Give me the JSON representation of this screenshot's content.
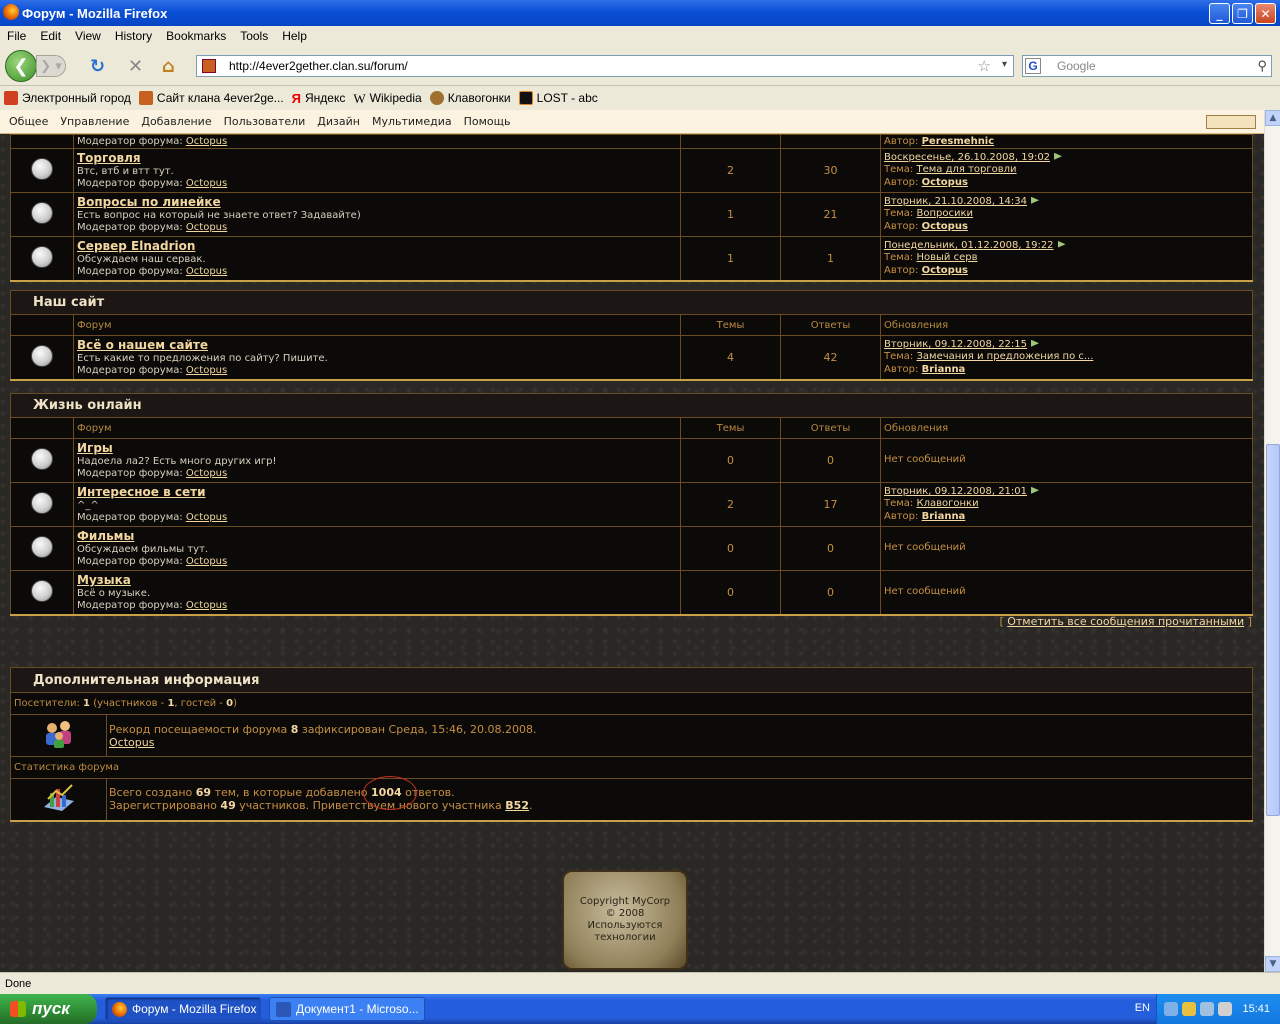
{
  "window": {
    "title": "Форум - Mozilla Firefox"
  },
  "menu": [
    "File",
    "Edit",
    "View",
    "History",
    "Bookmarks",
    "Tools",
    "Help"
  ],
  "nav": {
    "url": "http://4ever2gether.clan.su/forum/",
    "search_placeholder": "Google"
  },
  "bookmarks": [
    "Электронный город",
    "Сайт клана 4ever2ge...",
    "Яндекс",
    "Wikipedia",
    "Клавогонки",
    "LOST - abc"
  ],
  "admin_menu": [
    "Общее",
    "Управление",
    "Добавление",
    "Пользователи",
    "Дизайн",
    "Мультимедиа",
    "Помощь"
  ],
  "partial_row": {
    "author_label": "Автор:",
    "author": "Peresmehnic",
    "mod_label": "Модератор форума:",
    "mod": "Octopus"
  },
  "forums_top": [
    {
      "name": "Торговля",
      "desc": "Втс, втб и втт тут.",
      "mod_label": "Модератор форума:",
      "mod": "Octopus",
      "topics": "2",
      "replies": "30",
      "date": "Воскресенье, 26.10.2008, 19:02",
      "topic_label": "Тема:",
      "topic": "Тема для торговли",
      "author_label": "Автор:",
      "author": "Octopus"
    },
    {
      "name": "Вопросы по линейке",
      "desc": "Есть вопрос на который не знаете ответ? Задавайте)",
      "mod_label": "Модератор форума:",
      "mod": "Octopus",
      "topics": "1",
      "replies": "21",
      "date": "Вторник, 21.10.2008, 14:34",
      "topic_label": "Тема:",
      "topic": "Вопросики",
      "author_label": "Автор:",
      "author": "Octopus"
    },
    {
      "name": "Сервер Elnadrion",
      "desc": "Обсуждаем наш сервак.",
      "mod_label": "Модератор форума:",
      "mod": "Octopus",
      "topics": "1",
      "replies": "1",
      "date": "Понедельник, 01.12.2008, 19:22",
      "topic_label": "Тема:",
      "topic": "Новый серв",
      "author_label": "Автор:",
      "author": "Octopus"
    }
  ],
  "columns": {
    "forum": "Форум",
    "topics": "Темы",
    "replies": "Ответы",
    "updates": "Обновления"
  },
  "cat_site": {
    "title": "Наш сайт",
    "forums": [
      {
        "name": "Всё о нашем сайте",
        "desc": "Есть какие то предложения по сайту? Пишите.",
        "mod_label": "Модератор форума:",
        "mod": "Octopus",
        "topics": "4",
        "replies": "42",
        "date": "Вторник, 09.12.2008, 22:15",
        "topic_label": "Тема:",
        "topic": "Замечания и предложения по с...",
        "author_label": "Автор:",
        "author": "Brianna"
      }
    ]
  },
  "cat_life": {
    "title": "Жизнь онлайн",
    "forums": [
      {
        "name": "Игры",
        "desc": "Надоела ла2? Есть много других игр!",
        "mod_label": "Модератор форума:",
        "mod": "Octopus",
        "topics": "0",
        "replies": "0",
        "empty": "Нет сообщений"
      },
      {
        "name": "Интересное в сети",
        "desc": "^_^",
        "mod_label": "Модератор форума:",
        "mod": "Octopus",
        "topics": "2",
        "replies": "17",
        "date": "Вторник, 09.12.2008, 21:01",
        "topic_label": "Тема:",
        "topic": "Клавогонки",
        "author_label": "Автор:",
        "author": "Brianna"
      },
      {
        "name": "Фильмы",
        "desc": "Обсуждаем фильмы тут.",
        "mod_label": "Модератор форума:",
        "mod": "Octopus",
        "topics": "0",
        "replies": "0",
        "empty": "Нет сообщений"
      },
      {
        "name": "Музыка",
        "desc": "Всё о музыке.",
        "mod_label": "Модератор форума:",
        "mod": "Octopus",
        "topics": "0",
        "replies": "0",
        "empty": "Нет сообщений"
      }
    ]
  },
  "mark_all": "Отметить все сообщения прочитанными",
  "info": {
    "title": "Дополнительная информация",
    "visitors_label": "Посетители:",
    "visitors": "1",
    "visitors_members_label": "(участников -",
    "visitors_members": "1",
    "visitors_guests_label": ", гостей -",
    "visitors_guests": "0",
    "record_pre": "Рекорд посещаемости форума",
    "record_count": "8",
    "record_post": "зафиксирован Среда, 15:46, 20.08.2008.",
    "record_user": "Octopus",
    "stats_label": "Статистика форума",
    "stats_pre": "Всего создано",
    "stats_topics": "69",
    "stats_mid": "тем, в которые добавлено",
    "stats_replies": "1004",
    "stats_post": "ответов.",
    "reg_pre": "Зарегистрировано",
    "reg_count": "49",
    "reg_mid": "участников. Приветствуем нового участника",
    "reg_user": "B52"
  },
  "plaque": [
    "Copyright MyCorp",
    "© 2008",
    "Используются",
    "технологии"
  ],
  "status": "Done",
  "taskbar": {
    "start": "пуск",
    "items": [
      "Форум - Mozilla Firefox",
      "Документ1 - Microso..."
    ],
    "lang": "EN",
    "time": "15:41"
  }
}
